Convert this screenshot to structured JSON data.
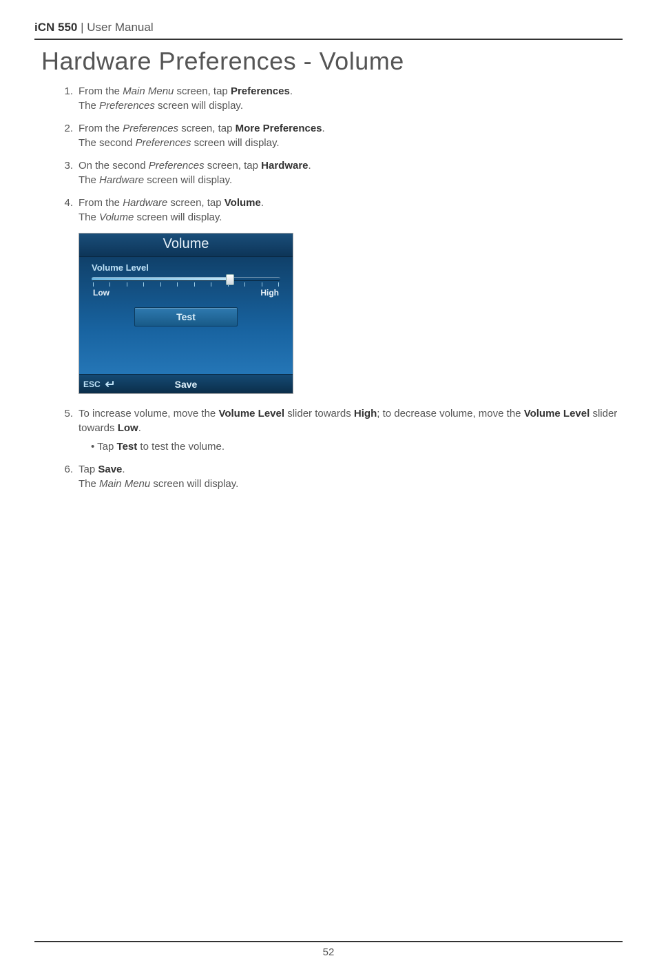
{
  "header": {
    "product_bold": "iCN 550",
    "divider": " | ",
    "doc_type": "User Manual"
  },
  "page_title": "Hardware Preferences - Volume",
  "steps": [
    {
      "num": "1.",
      "parts": [
        {
          "t": "text",
          "v": "From the "
        },
        {
          "t": "i",
          "v": "Main Menu"
        },
        {
          "t": "text",
          "v": " screen, tap "
        },
        {
          "t": "b",
          "v": "Preferences"
        },
        {
          "t": "text",
          "v": "."
        }
      ],
      "line2_parts": [
        {
          "t": "text",
          "v": "The "
        },
        {
          "t": "i",
          "v": "Preferences"
        },
        {
          "t": "text",
          "v": " screen will display."
        }
      ]
    },
    {
      "num": "2.",
      "parts": [
        {
          "t": "text",
          "v": "From the "
        },
        {
          "t": "i",
          "v": "Preferences"
        },
        {
          "t": "text",
          "v": " screen, tap "
        },
        {
          "t": "b",
          "v": "More Preferences"
        },
        {
          "t": "text",
          "v": "."
        }
      ],
      "line2_parts": [
        {
          "t": "text",
          "v": "The second "
        },
        {
          "t": "i",
          "v": "Preferences"
        },
        {
          "t": "text",
          "v": " screen will display."
        }
      ]
    },
    {
      "num": "3.",
      "parts": [
        {
          "t": "text",
          "v": "On the second "
        },
        {
          "t": "i",
          "v": "Preferences"
        },
        {
          "t": "text",
          "v": " screen, tap "
        },
        {
          "t": "b",
          "v": "Hardware"
        },
        {
          "t": "text",
          "v": "."
        }
      ],
      "line2_parts": [
        {
          "t": "text",
          "v": "The "
        },
        {
          "t": "i",
          "v": "Hardware"
        },
        {
          "t": "text",
          "v": " screen will display."
        }
      ]
    },
    {
      "num": "4.",
      "parts": [
        {
          "t": "text",
          "v": "From the "
        },
        {
          "t": "i",
          "v": "Hardware"
        },
        {
          "t": "text",
          "v": " screen, tap "
        },
        {
          "t": "b",
          "v": "Volume"
        },
        {
          "t": "text",
          "v": "."
        }
      ],
      "line2_parts": [
        {
          "t": "text",
          "v": "The "
        },
        {
          "t": "i",
          "v": "Volume"
        },
        {
          "t": "text",
          "v": " screen will display."
        }
      ]
    }
  ],
  "device": {
    "title": "Volume",
    "label": "Volume Level",
    "low": "Low",
    "high": "High",
    "test": "Test",
    "esc": "ESC",
    "save": "Save"
  },
  "after_steps": [
    {
      "num": "5.",
      "parts": [
        {
          "t": "text",
          "v": "To increase volume, move the "
        },
        {
          "t": "b",
          "v": "Volume Level"
        },
        {
          "t": "text",
          "v": " slider towards "
        },
        {
          "t": "b",
          "v": "High"
        },
        {
          "t": "text",
          "v": "; to decrease volume, move the "
        },
        {
          "t": "b",
          "v": "Volume Level"
        },
        {
          "t": "text",
          "v": " slider towards "
        },
        {
          "t": "b",
          "v": "Low"
        },
        {
          "t": "text",
          "v": "."
        }
      ],
      "bullet_parts": [
        {
          "t": "text",
          "v": "Tap "
        },
        {
          "t": "b",
          "v": "Test"
        },
        {
          "t": "text",
          "v": " to test the volume."
        }
      ]
    },
    {
      "num": "6.",
      "parts": [
        {
          "t": "text",
          "v": "Tap "
        },
        {
          "t": "b",
          "v": "Save"
        },
        {
          "t": "text",
          "v": "."
        }
      ],
      "line2_parts": [
        {
          "t": "text",
          "v": "The "
        },
        {
          "t": "i",
          "v": "Main Menu"
        },
        {
          "t": "text",
          "v": " screen will display."
        }
      ]
    }
  ],
  "page_number": "52"
}
